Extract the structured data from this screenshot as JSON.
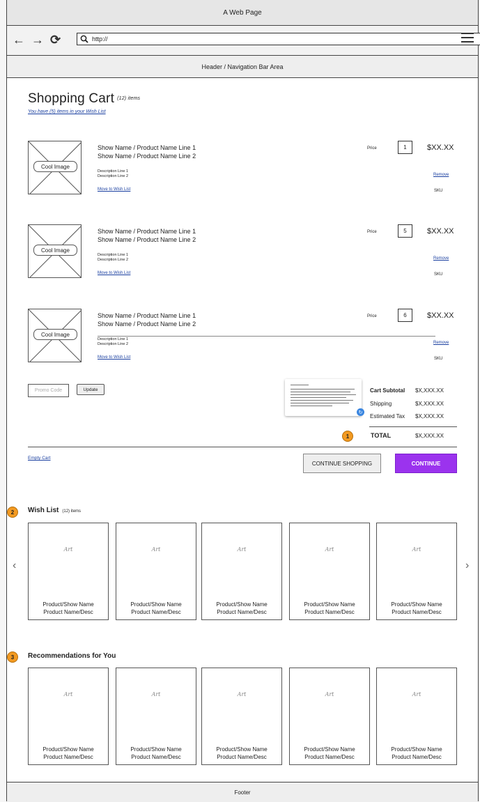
{
  "window": {
    "title": "A Web Page"
  },
  "browser": {
    "url": "http://"
  },
  "header": {
    "label": "Header / Navigation Bar Area"
  },
  "cart": {
    "title": "Shopping Cart",
    "item_count": "(12) items",
    "wishlist_note": "You have (5) items in your Wish List"
  },
  "products": [
    {
      "image_label": "Cool Image",
      "name_line1": "Show Name / Product Name Line 1",
      "name_line2": "Show Name / Product Name Line 2",
      "desc1": "Description Line 1",
      "desc2": "Description Line 2",
      "wish_link": "Move to Wish List",
      "price_label": "Price",
      "qty": "1",
      "price": "$XX.XX",
      "remove": "Remove",
      "sku": "SKU"
    },
    {
      "image_label": "Cool Image",
      "name_line1": "Show Name / Product Name Line 1",
      "name_line2": "Show Name / Product Name Line 2",
      "desc1": "Description Line 1",
      "desc2": "Description Line 2",
      "wish_link": "Move to Wish List",
      "price_label": "Price",
      "qty": "5",
      "price": "$XX.XX",
      "remove": "Remove",
      "sku": "SKU"
    },
    {
      "image_label": "Cool Image",
      "name_line1": "Show Name / Product Name Line 1",
      "name_line2": "Show Name / Product Name Line 2",
      "desc1": "Description Line 1",
      "desc2": "Description Line 2",
      "wish_link": "Move to Wish List",
      "price_label": "Price",
      "qty": "6",
      "price": "$XX.XX",
      "remove": "Remove",
      "sku": "SKU"
    }
  ],
  "promo": {
    "placeholder": "Promo Code",
    "update": "Update"
  },
  "summary": {
    "subtotal_label": "Cart Subtotal",
    "subtotal": "$X,XXX.XX",
    "shipping_label": "Shipping",
    "shipping": "$X,XXX.XX",
    "tax_label": "Estimated Tax",
    "tax": "$X,XXX.XX",
    "total_label": "TOTAL",
    "total": "$X,XXX.XX"
  },
  "actions": {
    "empty_cart": "Empty Cart",
    "continue_shopping": "CONTINUE SHOPPING",
    "continue": "CONTINUE"
  },
  "badges": {
    "b1": "1",
    "b2": "2",
    "b3": "3"
  },
  "wishlist": {
    "title": "Wish List",
    "count": "(12) items",
    "items": [
      {
        "art": "Art",
        "line1": "Product/Show Name",
        "line2": "Product Name/Desc"
      },
      {
        "art": "Art",
        "line1": "Product/Show Name",
        "line2": "Product Name/Desc"
      },
      {
        "art": "Art",
        "line1": "Product/Show Name",
        "line2": "Product Name/Desc"
      },
      {
        "art": "Art",
        "line1": "Product/Show Name",
        "line2": "Product Name/Desc"
      },
      {
        "art": "Art",
        "line1": "Product/Show Name",
        "line2": "Product Name/Desc"
      }
    ]
  },
  "recommendations": {
    "title": "Recommendations for You",
    "items": [
      {
        "art": "Art",
        "line1": "Product/Show Name",
        "line2": "Product Name/Desc"
      },
      {
        "art": "Art",
        "line1": "Product/Show Name",
        "line2": "Product Name/Desc"
      },
      {
        "art": "Art",
        "line1": "Product/Show Name",
        "line2": "Product Name/Desc"
      },
      {
        "art": "Art",
        "line1": "Product/Show Name",
        "line2": "Product Name/Desc"
      },
      {
        "art": "Art",
        "line1": "Product/Show Name",
        "line2": "Product Name/Desc"
      }
    ]
  },
  "footer": {
    "label": "Footer"
  },
  "colors": {
    "continue_button": "#9b33ee",
    "badge": "#f39a21",
    "link": "#1a3fa0"
  }
}
